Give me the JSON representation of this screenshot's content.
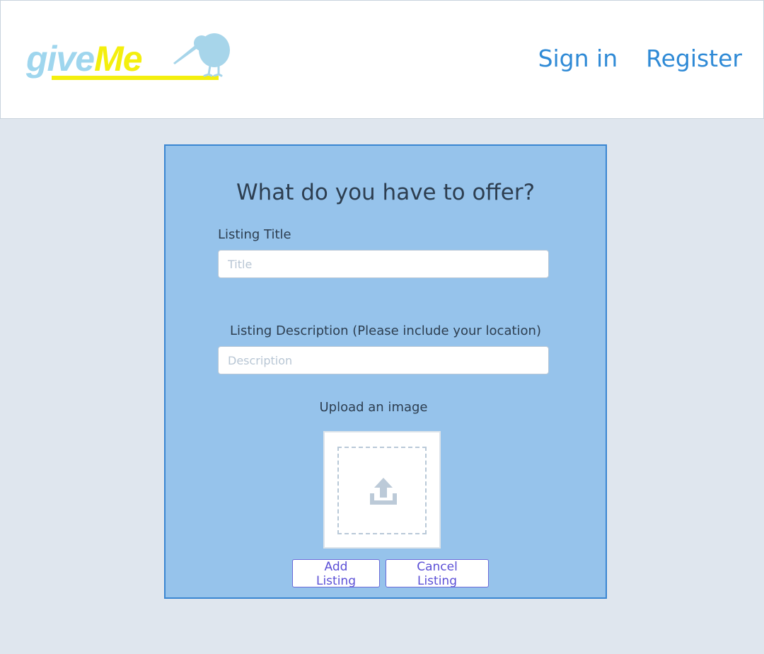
{
  "header": {
    "logo": {
      "part1": "give",
      "part2": "Me"
    },
    "nav": {
      "signin": "Sign in",
      "register": "Register"
    }
  },
  "form": {
    "title": "What do you have to offer?",
    "listing_title_label": "Listing Title",
    "listing_title_placeholder": "Title",
    "listing_title_value": "",
    "description_label": "Listing Description (Please include your location)",
    "description_placeholder": "Description",
    "description_value": "",
    "upload_label": "Upload an image",
    "upload_icon": "upload-icon",
    "add_button": "Add Listing",
    "cancel_button": "Cancel Listing"
  },
  "colors": {
    "page_bg": "#dfe6ee",
    "card_bg": "#96c3eb",
    "card_border": "#3a86d1",
    "nav_link": "#2f8ad6",
    "logo_blue": "#9fd6ee",
    "logo_yellow": "#f4ef0e",
    "button_text": "#5b4fd6"
  }
}
